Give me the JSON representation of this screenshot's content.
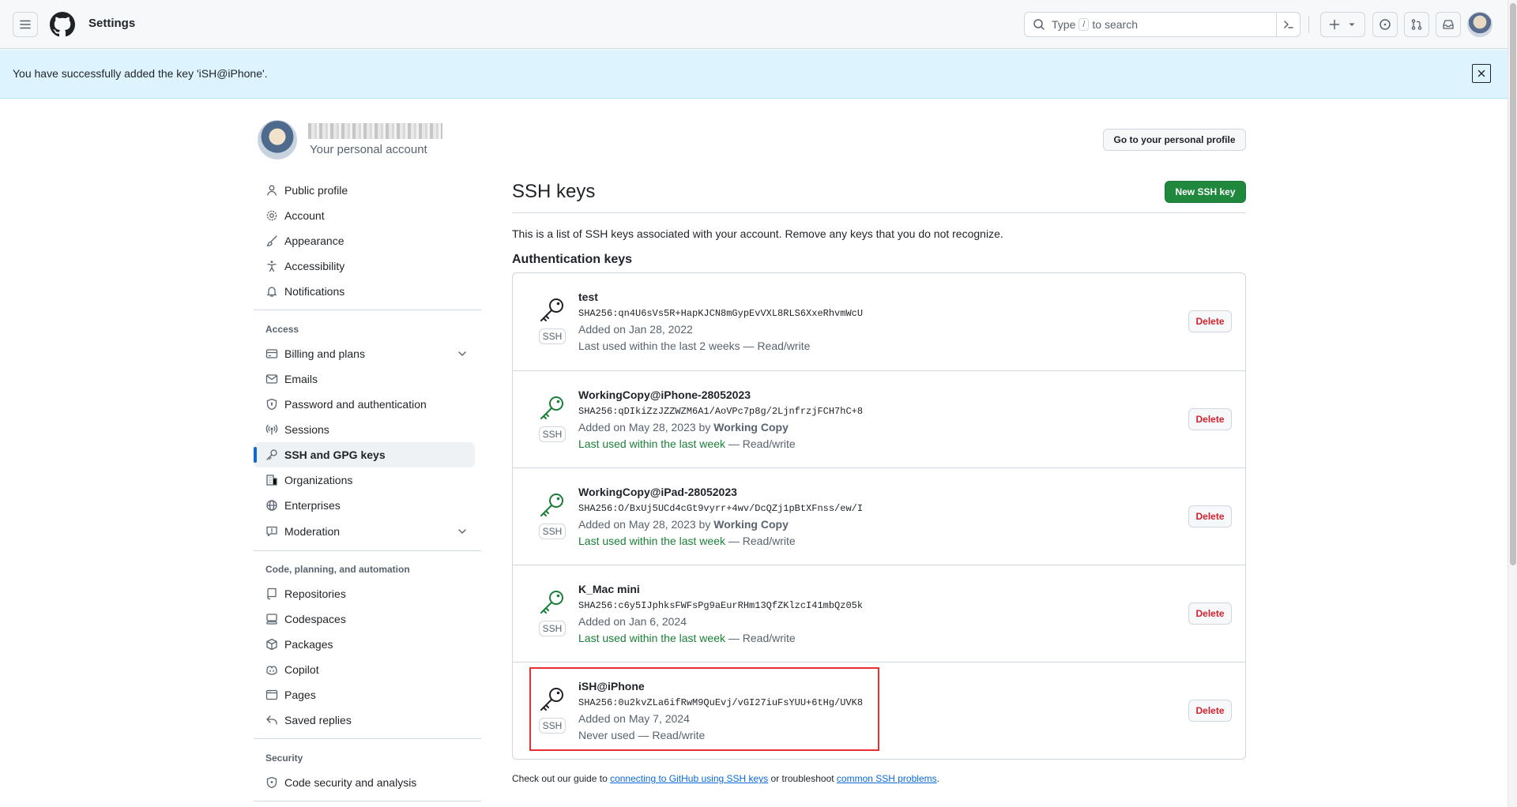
{
  "header": {
    "context_title": "Settings",
    "search_pre": "Type",
    "search_key": "/",
    "search_post": "to search"
  },
  "flash": {
    "message": "You have successfully added the key 'iSH@iPhone'."
  },
  "account": {
    "subtitle": "Your personal account",
    "profile_button": "Go to your personal profile"
  },
  "sidebar": {
    "top_items": [
      {
        "label": "Public profile",
        "icon": "person-icon"
      },
      {
        "label": "Account",
        "icon": "gear-icon"
      },
      {
        "label": "Appearance",
        "icon": "paintbrush-icon"
      },
      {
        "label": "Accessibility",
        "icon": "accessibility-icon"
      },
      {
        "label": "Notifications",
        "icon": "bell-icon"
      }
    ],
    "access_heading": "Access",
    "access_items": [
      {
        "label": "Billing and plans",
        "icon": "credit-card-icon"
      },
      {
        "label": "Emails",
        "icon": "mail-icon"
      },
      {
        "label": "Password and authentication",
        "icon": "shield-lock-icon"
      },
      {
        "label": "Sessions",
        "icon": "broadcast-icon"
      },
      {
        "label": "SSH and GPG keys",
        "icon": "key-icon"
      },
      {
        "label": "Organizations",
        "icon": "organization-icon"
      },
      {
        "label": "Enterprises",
        "icon": "globe-icon"
      },
      {
        "label": "Moderation",
        "icon": "report-icon"
      }
    ],
    "code_heading": "Code, planning, and automation",
    "code_items": [
      {
        "label": "Repositories",
        "icon": "repo-icon"
      },
      {
        "label": "Codespaces",
        "icon": "codespaces-icon"
      },
      {
        "label": "Packages",
        "icon": "package-icon"
      },
      {
        "label": "Copilot",
        "icon": "copilot-icon"
      },
      {
        "label": "Pages",
        "icon": "browser-icon"
      },
      {
        "label": "Saved replies",
        "icon": "reply-icon"
      }
    ],
    "security_heading": "Security",
    "security_items": [
      {
        "label": "Code security and analysis",
        "icon": "shield-icon"
      }
    ]
  },
  "main": {
    "title": "SSH keys",
    "new_button": "New SSH key",
    "intro": "This is a list of SSH keys associated with your account. Remove any keys that you do not recognize.",
    "auth_heading": "Authentication keys",
    "badge": "SSH",
    "delete_label": "Delete",
    "keys": [
      {
        "title": "test",
        "fingerprint": "SHA256:qn4U6sVs5R+HapKJCN8mGypEvVXL8RLS6XxeRhvmWcU",
        "added": "Added on Jan 28, 2022",
        "added_by": "",
        "used": "Last used within the last 2 weeks",
        "access": " — Read/write"
      },
      {
        "title": "WorkingCopy@iPhone-28052023",
        "fingerprint": "SHA256:qDIkiZzJZZWZM6A1/AoVPc7p8g/2LjnfrzjFCH7hC+8",
        "added": "Added on May 28, 2023 by ",
        "added_by": "Working Copy",
        "used": "Last used within the last week",
        "access": " — Read/write"
      },
      {
        "title": "WorkingCopy@iPad-28052023",
        "fingerprint": "SHA256:O/BxUj5UCd4cGt9vyrr+4wv/DcQZj1pBtXFnss/ew/I",
        "added": "Added on May 28, 2023 by ",
        "added_by": "Working Copy",
        "used": "Last used within the last week",
        "access": " — Read/write"
      },
      {
        "title": "K_Mac mini",
        "fingerprint": "SHA256:c6y5IJphksFWFsPg9aEurRHm13QfZKlzcI41mbQz05k",
        "added": "Added on Jan 6, 2024",
        "added_by": "",
        "used": "Last used within the last week",
        "access": " — Read/write"
      },
      {
        "title": "iSH@iPhone",
        "fingerprint": "SHA256:0u2kvZLa6ifRwM9QuEvj/vGI27iuFsYUU+6tHg/UVK8",
        "added": "Added on May 7, 2024",
        "added_by": "",
        "used": "Never used",
        "access": " — Read/write"
      }
    ],
    "footer_pre": "Check out our guide to ",
    "footer_link1": "connecting to GitHub using SSH keys",
    "footer_mid": " or troubleshoot ",
    "footer_link2": "common SSH problems",
    "footer_post": "."
  },
  "colors": {
    "primary_button": "#1f883d",
    "danger": "#cf222e",
    "link": "#0969da",
    "flash_bg": "#ddf4ff",
    "highlight_box": "#e5322e",
    "recent_use": "#1a7f37"
  }
}
